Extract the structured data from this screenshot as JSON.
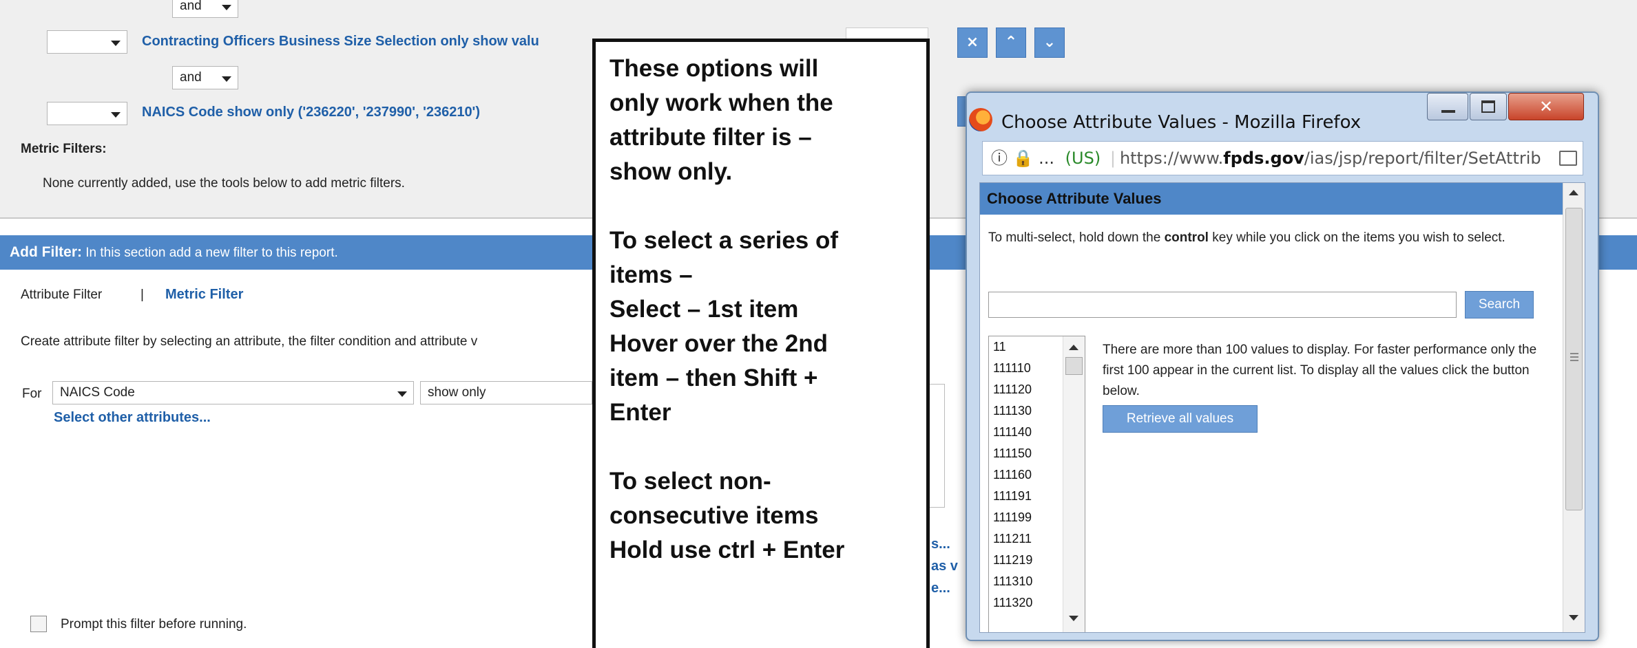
{
  "report": {
    "and_1": "and",
    "row_contracting": "Contracting Officers Business Size Selection only show valu",
    "and_2": "and",
    "row_naics": "NAICS Code show only ('236220', '237990', '236210')",
    "metric_filters_label": "Metric Filters:",
    "metric_filters_note": "None currently added, use the tools below to add metric filters.",
    "btn_remove": "×",
    "btn_up": "⌃",
    "btn_down": "⌄"
  },
  "add_filter": {
    "title": "Add Filter:",
    "subtitle": "In this section add a new filter to this report.",
    "tab_attribute": "Attribute Filter",
    "tab_separator": "|",
    "tab_metric": "Metric Filter",
    "instructions": "Create attribute filter by selecting an attribute, the filter condition and attribute v",
    "for_label": "For",
    "attribute_value": "NAICS Code",
    "condition_value": "show only",
    "select_other": "Select other attributes...",
    "frag_1": "s...",
    "frag_2": "as v",
    "frag_3": "e...",
    "prompt_label": "Prompt this filter before running."
  },
  "callout": {
    "lines_1": [
      "These options will",
      "only work when the",
      "attribute filter is –",
      "show only."
    ],
    "lines_2": [
      "To select a series of",
      "items –",
      "Select – 1st item",
      "Hover over the 2nd",
      "item – then Shift +",
      "Enter"
    ],
    "lines_3": [
      "To select non-",
      "consecutive items",
      "Hold use ctrl + Enter"
    ]
  },
  "popup": {
    "window_title": "Choose Attribute Values - Mozilla Firefox",
    "url_prefix": "ⓘ 🔒 ...",
    "url_region": "(US)",
    "url_scheme": "https://www.",
    "url_domain": "fpds.gov",
    "url_path": "/ias/jsp/report/filter/SetAttrib",
    "header": "Choose Attribute Values",
    "instr_pre": "To multi-select, hold down the ",
    "instr_bold": "control",
    "instr_post": " key while you click on the items you wish to select.",
    "search_placeholder": "",
    "search_button": "Search",
    "values": [
      "11",
      "111110",
      "111120",
      "111130",
      "111140",
      "111150",
      "111160",
      "111191",
      "111199",
      "111211",
      "111219",
      "111310",
      "111320"
    ],
    "note": "There are more than 100 values to display. For faster performance only the first 100 appear in the current list. To display all the values click the button below.",
    "retrieve_button": "Retrieve all values"
  },
  "colors": {
    "accent_blue": "#4f87c8",
    "link_blue": "#1f5fa8",
    "button_blue": "#6f9fd8"
  }
}
